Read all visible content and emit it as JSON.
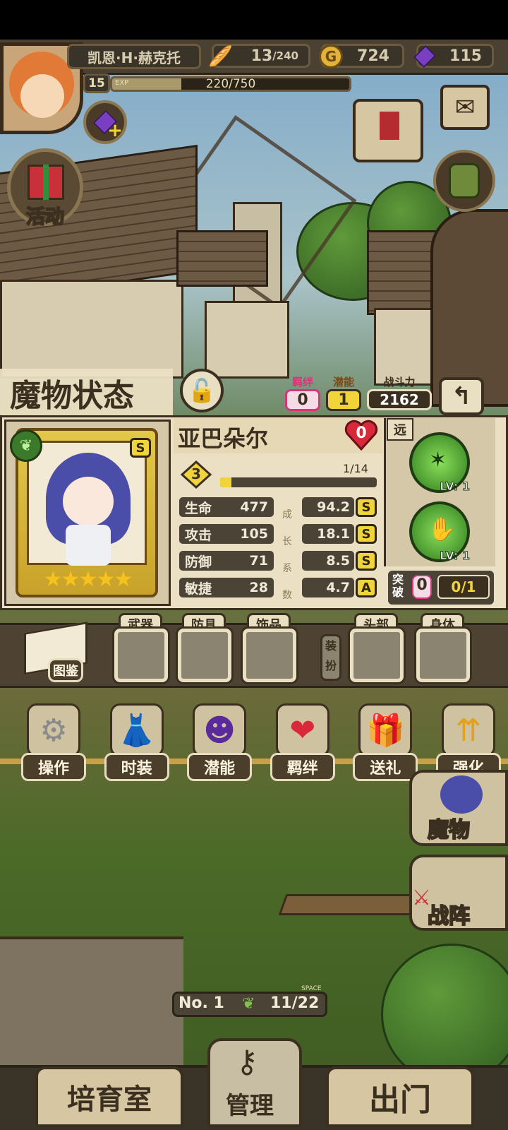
{
  "player": {
    "name": "凯恩·H·赫克托",
    "level": "15",
    "exp_label": "EXP",
    "exp_text": "220/750",
    "exp_progress": 0.293
  },
  "resources": {
    "stamina": "13",
    "stamina_max": "/240",
    "gold": "724",
    "gems": "115"
  },
  "top_buttons": {
    "events": "活动"
  },
  "panel": {
    "title": "魔物状态",
    "bond_label": "羁绊",
    "bond_value": "0",
    "potential_label": "潜能",
    "potential_value": "1",
    "power_label": "战斗力",
    "power_value": "2162",
    "range_label": "远",
    "monster": {
      "name": "亚巴朵尔",
      "hearts": "0",
      "rank": "3",
      "rank_progress_text": "1/14",
      "rank_progress": 0.071,
      "grade": "S",
      "stars": 5
    },
    "growth_label": [
      "成",
      "长",
      "系",
      "数"
    ],
    "stats": [
      {
        "label": "生命",
        "value": "477",
        "growth": "94.2",
        "grade": "S"
      },
      {
        "label": "攻击",
        "value": "105",
        "growth": "18.1",
        "grade": "S"
      },
      {
        "label": "防御",
        "value": "71",
        "growth": "8.5",
        "grade": "S"
      },
      {
        "label": "敏捷",
        "value": "28",
        "growth": "4.7",
        "grade": "A"
      }
    ],
    "skills": [
      {
        "level": "LV: 1"
      },
      {
        "level": "LV: 1"
      }
    ],
    "breakthrough_label": "突破",
    "breakthrough_value": "0",
    "breakthrough_count": "0/1"
  },
  "equipment": {
    "codex_label": "图鉴",
    "slots": [
      "武器",
      "防具",
      "饰品"
    ],
    "equip_label": "装扮",
    "wear_slots": [
      "头部",
      "身体"
    ]
  },
  "menu": [
    "操作",
    "时装",
    "潜能",
    "羁绊",
    "送礼",
    "强化"
  ],
  "side": {
    "monsters": "魔物",
    "formation": "战阵"
  },
  "bottom": {
    "no_label": "No. 1",
    "space_label": "SPACE",
    "space_value": "11/22",
    "nursery": "培育室",
    "manage": "管理",
    "depart": "出门"
  },
  "colors": {
    "accent_gold": "#f1d33a",
    "hud_bg": "#3a3327",
    "panel_bg": "#ebe0c3",
    "heart_red": "#d8283a",
    "skill_green": "#4ac23a"
  }
}
